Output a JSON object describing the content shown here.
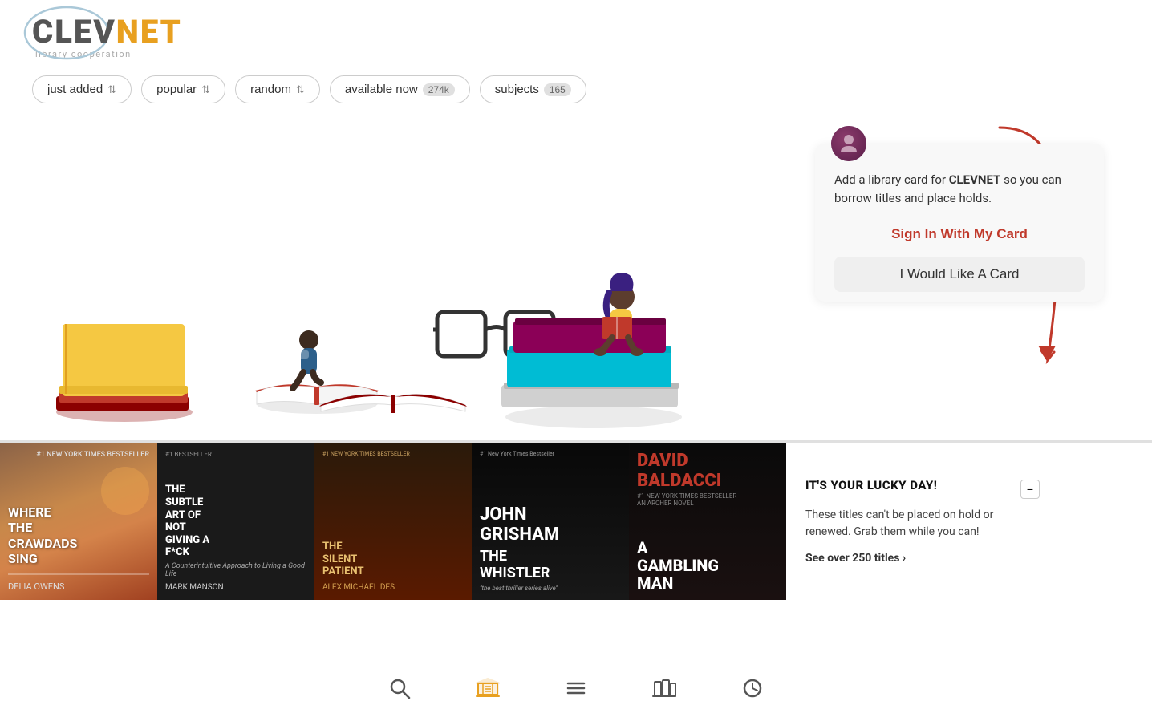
{
  "logo": {
    "clev": "CLEV",
    "net": "NET",
    "tagline": "library cooperation"
  },
  "filters": [
    {
      "id": "just-added",
      "label": "just added",
      "badge": null,
      "sort": true
    },
    {
      "id": "popular",
      "label": "popular",
      "badge": null,
      "sort": true
    },
    {
      "id": "random",
      "label": "random",
      "badge": null,
      "sort": true
    },
    {
      "id": "available-now",
      "label": "available now",
      "badge": "274k",
      "sort": false
    },
    {
      "id": "subjects",
      "label": "subjects",
      "badge": "165",
      "sort": false
    }
  ],
  "popup": {
    "text_before": "Add a library card for ",
    "org_name": "CLEVNET",
    "text_after": " so you can borrow titles and place holds.",
    "sign_in_label": "Sign In With My Card",
    "get_card_label": "I Would Like A Card"
  },
  "lucky_day": {
    "title": "IT'S YOUR LUCKY DAY!",
    "description": "These titles can't be placed on hold or renewed. Grab them while you can!",
    "link_label": "See over 250 titles",
    "close_label": "−"
  },
  "books": [
    {
      "id": "crawdads",
      "title": "WHERE THE CRAWDADS SING",
      "author": "DELIA OWENS",
      "bg": "#8B6347",
      "text_color": "#fff"
    },
    {
      "id": "subtle-art",
      "title": "THE SUBTLE ART OF NOT GIVING A F*CK",
      "author": "MARK MANSON",
      "bg": "#1a1a1a",
      "text_color": "#fff"
    },
    {
      "id": "silent-patient",
      "title": "THE SILENT PATIENT",
      "author": "ALEX MICHAELIDES",
      "bg": "#2a1f1f",
      "text_color": "#e8c89a"
    },
    {
      "id": "whistler",
      "title": "THE WHISTLER",
      "author": "JOHN GRISHAM",
      "bg": "#0a0a0a",
      "text_color": "#fff"
    },
    {
      "id": "gambling-man",
      "title": "A GAMBLING MAN",
      "author": "DAVID BALDACCI",
      "bg": "#111",
      "text_color": "#fff"
    }
  ],
  "bottom_nav": [
    {
      "id": "search",
      "label": "search",
      "icon": "🔍",
      "active": false
    },
    {
      "id": "library",
      "label": "library",
      "icon": "🏛️",
      "active": true
    },
    {
      "id": "menu",
      "label": "menu",
      "icon": "☰",
      "active": false
    },
    {
      "id": "shelf",
      "label": "shelf",
      "icon": "📚",
      "active": false
    },
    {
      "id": "history",
      "label": "history",
      "icon": "🕐",
      "active": false
    }
  ]
}
